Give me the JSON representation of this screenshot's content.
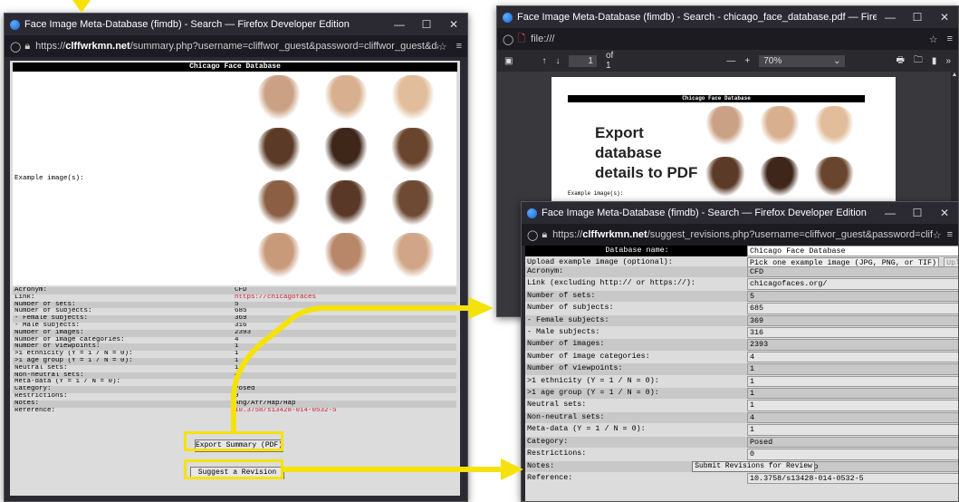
{
  "left_window": {
    "title": "Face Image Meta-Database (fimdb) - Search — Firefox Developer Edition",
    "url_prefix": "https://",
    "url_domain": "clffwrkmn.net",
    "url_rest": "/summary.php?username=cliffwor_guest&password=cliffwor_guest&database=",
    "banner": "Chicago Face Database",
    "example_label": "Example image(s):",
    "rows": [
      {
        "label": "Acronym:",
        "value": "CFD"
      },
      {
        "label": "Link:",
        "value": "https://chicagofaces",
        "link": true
      },
      {
        "label": "Number of sets:",
        "value": "5"
      },
      {
        "label": "Number of subjects:",
        "value": "685"
      },
      {
        "label": "- Female subjects:",
        "value": "369"
      },
      {
        "label": "- Male subjects:",
        "value": "316"
      },
      {
        "label": "Number of images:",
        "value": "2393"
      },
      {
        "label": "Number of image categories:",
        "value": "4"
      },
      {
        "label": "Number of viewpoints:",
        "value": "1"
      },
      {
        "label": ">1 ethnicity (Y = 1 / N = 0):",
        "value": "1"
      },
      {
        "label": ">1 age group (Y = 1 / N = 0):",
        "value": "1"
      },
      {
        "label": "Neutral sets:",
        "value": "1"
      },
      {
        "label": "Non-neutral sets:",
        "value": "4"
      },
      {
        "label": "Meta-data (Y = 1 / N = 0):",
        "value": "1"
      },
      {
        "label": "Category:",
        "value": "Posed"
      },
      {
        "label": "Restrictions:",
        "value": "0"
      },
      {
        "label": "Notes:",
        "value": "Ang/Afr/Hap/Hap"
      },
      {
        "label": "Reference:",
        "value": "10.3758/s13428-014-0532-5",
        "link": true
      }
    ],
    "export_button": "Export Summary (PDF)",
    "suggest_button": "Suggest a Revision"
  },
  "pdf_window": {
    "title": "Face Image Meta-Database (fimdb) - Search - chicago_face_database.pdf — Firefox Developer Edition",
    "url": "file:///",
    "page_input": "1",
    "page_total": "of 1",
    "zoom": "70%",
    "banner": "Chicago Face Database",
    "example_label": "Example image(s):"
  },
  "callout": {
    "text": "Export database details to PDF"
  },
  "revise_window": {
    "title": "Face Image Meta-Database (fimdb) - Search — Firefox Developer Edition",
    "url_prefix": "https://",
    "url_domain": "clffwrkmn.net",
    "url_rest": "/suggest_revisions.php?username=cliffwor_guest&password=cliffwor_guest&d",
    "header_label": "Database name:",
    "header_value": "Chicago Face Database",
    "upload_label": "Upload example image (optional):",
    "upload_value": "Pick one example image (JPG, PNG, or TIF)",
    "upload_button": "Upload",
    "rows": [
      {
        "label": "Acronym:",
        "value": "CFD"
      },
      {
        "label": "Link (excluding http:// or https://):",
        "value": "chicagofaces.org/"
      },
      {
        "label": "Number of sets:",
        "value": "5"
      },
      {
        "label": "Number of subjects:",
        "value": "685"
      },
      {
        "label": "- Female subjects:",
        "value": "369"
      },
      {
        "label": "- Male subjects:",
        "value": "316"
      },
      {
        "label": "Number of images:",
        "value": "2393"
      },
      {
        "label": "Number of image categories:",
        "value": "4"
      },
      {
        "label": "Number of viewpoints:",
        "value": "1"
      },
      {
        "label": ">1 ethnicity (Y = 1 / N = 0):",
        "value": "1"
      },
      {
        "label": ">1 age group (Y = 1 / N = 0):",
        "value": "1"
      },
      {
        "label": "Neutral sets:",
        "value": "1"
      },
      {
        "label": "Non-neutral sets:",
        "value": "4"
      },
      {
        "label": "Meta-data (Y = 1 / N = 0):",
        "value": "1"
      },
      {
        "label": "Category:",
        "value": "Posed"
      },
      {
        "label": "Restrictions:",
        "value": "0"
      },
      {
        "label": "Notes:",
        "value": "Ang/Afr/Hap/Hap"
      },
      {
        "label": "Reference:",
        "value": "10.3758/s13428-014-0532-5"
      }
    ],
    "submit_button": "Submit Revisions for Review"
  },
  "face_colors": [
    "#caa184",
    "#d8b08f",
    "#e1bd9c",
    "#5b3a27",
    "#3e2619",
    "#6a452e",
    "#8a5f44",
    "#5a3828",
    "#6e4a34",
    "#c89a7a",
    "#b8876a",
    "#d1a688"
  ],
  "accent": {
    "highlight": "#f5e20a",
    "link": "#cc2233"
  }
}
